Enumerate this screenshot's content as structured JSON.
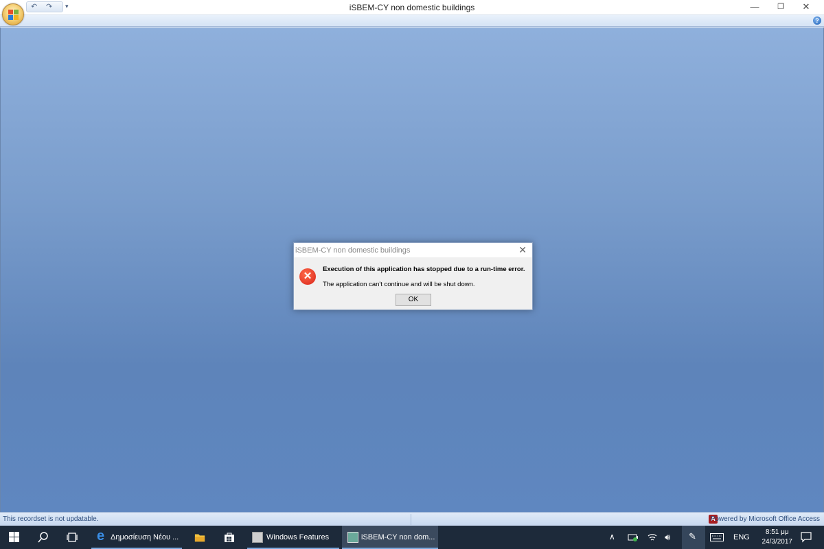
{
  "window": {
    "title": "iSBEM-CY non domestic buildings",
    "minimize": "—",
    "restore": "❐",
    "close": "✕"
  },
  "qat": {
    "undo": "↶",
    "redo": "↷",
    "customize": "▾"
  },
  "ribbon": {
    "help": "?"
  },
  "dialog": {
    "title": "iSBEM-CY non domestic buildings",
    "close": "✕",
    "heading": "Execution of this application has stopped due to a run-time error.",
    "message": "The application can't continue and will be shut down.",
    "ok": "OK",
    "icon": "error-icon"
  },
  "status": {
    "left": "This recordset is not updatable.",
    "right": "Powered by Microsoft Office Access"
  },
  "taskbar": {
    "apps": [
      {
        "label": "Δημοσίευση Νέου ...",
        "icon": "edge-icon"
      },
      {
        "label": "Windows Features",
        "icon": "windows-features-icon"
      },
      {
        "label": "iSBEM-CY non dom...",
        "icon": "isbem-icon"
      }
    ],
    "lang": "ENG",
    "time": "8:51 μμ",
    "date": "24/3/2017"
  },
  "colors": {
    "taskbar": "#1d2a3a",
    "workspace": "#6f93c6",
    "error": "#e0301e"
  }
}
